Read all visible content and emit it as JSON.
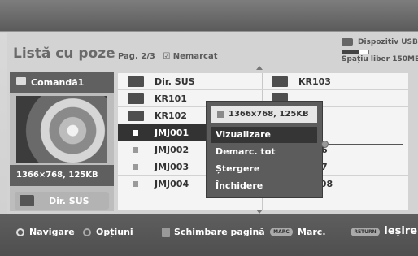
{
  "header": {
    "title": "Listă cu poze",
    "page": "Pag. 2/3",
    "filter_label": "Nemarcat",
    "filter_mark": "☑"
  },
  "usb": {
    "device": "Dispozitiv USB",
    "free_space": "Spațiu liber 150MB",
    "usage_fraction": 0.65
  },
  "preview": {
    "heading": "Comandă1",
    "resolution": "1366×768, 125KB",
    "up_button": "Dir. SUS"
  },
  "list": {
    "col1": [
      {
        "label": "Dir. SUS",
        "kind": "folder-up",
        "selected": false
      },
      {
        "label": "KR101",
        "kind": "folder",
        "selected": false
      },
      {
        "label": "KR102",
        "kind": "folder",
        "selected": false
      },
      {
        "label": "JMJ001",
        "kind": "file",
        "selected": true
      },
      {
        "label": "JMJ002",
        "kind": "file",
        "selected": false
      },
      {
        "label": "JMJ003",
        "kind": "file",
        "selected": false
      },
      {
        "label": "JMJ004",
        "kind": "file",
        "selected": false
      }
    ],
    "col2": [
      {
        "label": "KR103",
        "kind": "folder"
      },
      {
        "label": "",
        "kind": "folder"
      },
      {
        "label": "",
        "kind": "folder"
      },
      {
        "label": "",
        "kind": "file"
      },
      {
        "label": "6",
        "kind": "file"
      },
      {
        "label": "7",
        "kind": "file"
      },
      {
        "label": "JMJ008",
        "kind": "file"
      }
    ]
  },
  "popup": {
    "info": "1366x768, 125KB",
    "options": [
      "Vizualizare",
      "Demarc. tot",
      "Ștergere",
      "Închidere"
    ],
    "selected_index": 0
  },
  "footer": {
    "navigate": "Navigare",
    "options": "Opțiuni",
    "page_change": "Schimbare pagină",
    "mark_key": "MARC",
    "mark": "Marc.",
    "return_key": "RETURN",
    "exit": "Ieșire"
  }
}
